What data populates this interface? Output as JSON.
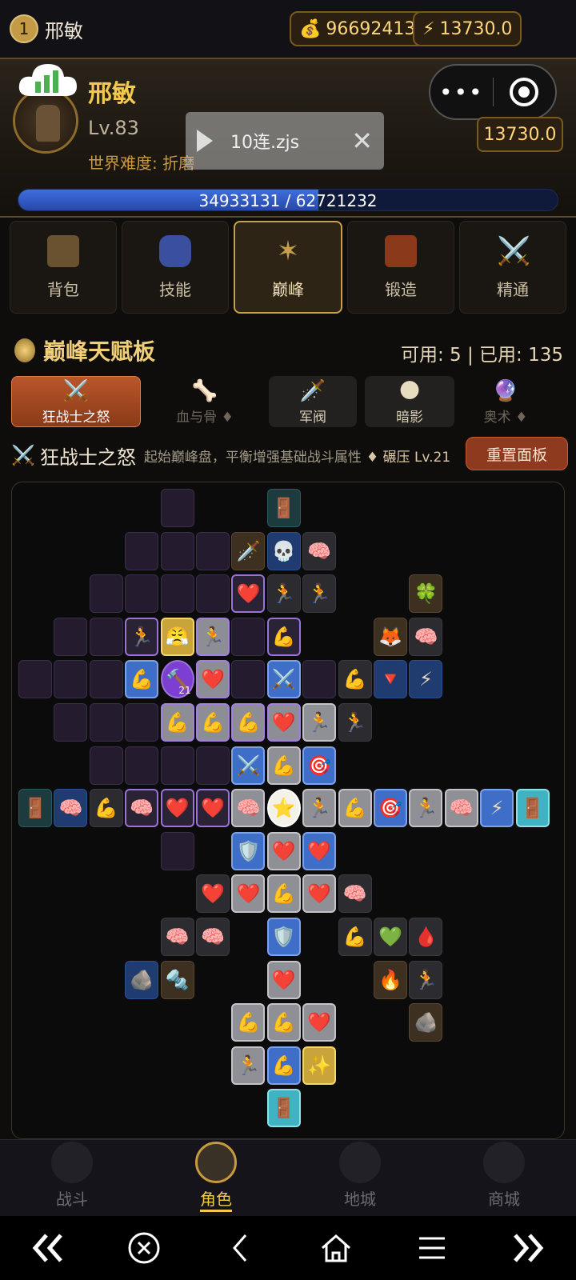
{
  "topbar": {
    "level_badge": "1",
    "player_name": "邢敏",
    "gold": "96692413",
    "energy": "13730.0"
  },
  "hero": {
    "name": "邢敏",
    "level": "Lv.83",
    "difficulty": "世界难度: 折磨",
    "energy": "13730.0",
    "xp_text": "34933131 / 62721232",
    "xp_progress": 0.557
  },
  "script_overlay": {
    "label": "10连.zjs"
  },
  "tabs": [
    {
      "label": "背包",
      "color": "#6a5230"
    },
    {
      "label": "技能",
      "color": "#3b4fa0"
    },
    {
      "label": "巅峰",
      "color": "#7a5a2a"
    },
    {
      "label": "锻造",
      "color": "#8a3a1a"
    },
    {
      "label": "精通",
      "color": "#8a8a9a"
    }
  ],
  "talent": {
    "title": "巅峰天赋板",
    "availability": "可用: 5 | 已用: 135"
  },
  "board_tabs": [
    {
      "icon": "⚔️",
      "label": "狂战士之怒"
    },
    {
      "icon": "🦴",
      "label": "血与骨 ♦"
    },
    {
      "icon": "🗡️",
      "label": "军阀"
    },
    {
      "icon": "🌑",
      "label": "暗影"
    },
    {
      "icon": "🔮",
      "label": "奥术 ♦"
    }
  ],
  "board_header": {
    "icon": "⚔️",
    "name": "狂战士之怒",
    "description": "起始巅峰盘，平衡增强基础战斗属性",
    "rune": "♦ 碾压 Lv.21",
    "reset_label": "重置面板"
  },
  "board": {
    "badge_value": "21",
    "cells": [
      {
        "c": 4,
        "r": 0,
        "s": "e"
      },
      {
        "c": 7,
        "r": 0,
        "s": "t",
        "i": "🚪"
      },
      {
        "c": 3,
        "r": 1,
        "s": "e"
      },
      {
        "c": 4,
        "r": 1,
        "s": "e"
      },
      {
        "c": 5,
        "r": 1,
        "s": "e"
      },
      {
        "c": 6,
        "r": 1,
        "s": "bn",
        "i": "🗡️"
      },
      {
        "c": 7,
        "r": 1,
        "s": "bd",
        "i": "💀"
      },
      {
        "c": 8,
        "r": 1,
        "s": "n",
        "i": "🧠"
      },
      {
        "c": 2,
        "r": 2,
        "s": "e"
      },
      {
        "c": 3,
        "r": 2,
        "s": "e"
      },
      {
        "c": 4,
        "r": 2,
        "s": "e"
      },
      {
        "c": 5,
        "r": 2,
        "s": "e"
      },
      {
        "c": 6,
        "r": 2,
        "s": "p",
        "i": "❤️"
      },
      {
        "c": 7,
        "r": 2,
        "s": "n",
        "i": "🏃"
      },
      {
        "c": 8,
        "r": 2,
        "s": "n",
        "i": "🏃"
      },
      {
        "c": 11,
        "r": 2,
        "s": "bn",
        "i": "🍀"
      },
      {
        "c": 1,
        "r": 3,
        "s": "e"
      },
      {
        "c": 2,
        "r": 3,
        "s": "e"
      },
      {
        "c": 3,
        "r": 3,
        "s": "p",
        "i": "🏃"
      },
      {
        "c": 4,
        "r": 3,
        "s": "y",
        "i": "😤"
      },
      {
        "c": 5,
        "r": 3,
        "s": "pp",
        "i": "🏃"
      },
      {
        "c": 6,
        "r": 3,
        "s": "e"
      },
      {
        "c": 7,
        "r": 3,
        "s": "p",
        "i": "💪"
      },
      {
        "c": 10,
        "r": 3,
        "s": "bn",
        "i": "🦊"
      },
      {
        "c": 11,
        "r": 3,
        "s": "n",
        "i": "🧠"
      },
      {
        "c": 0,
        "r": 4,
        "s": "e"
      },
      {
        "c": 1,
        "r": 4,
        "s": "e"
      },
      {
        "c": 2,
        "r": 4,
        "s": "e"
      },
      {
        "c": 3,
        "r": 4,
        "s": "b",
        "i": "💪"
      },
      {
        "c": 4,
        "r": 4,
        "s": "pr",
        "i": "🔨"
      },
      {
        "c": 5,
        "r": 4,
        "s": "pp",
        "i": "❤️"
      },
      {
        "c": 6,
        "r": 4,
        "s": "e"
      },
      {
        "c": 7,
        "r": 4,
        "s": "b",
        "i": "⚔️"
      },
      {
        "c": 8,
        "r": 4,
        "s": "e"
      },
      {
        "c": 9,
        "r": 4,
        "s": "n",
        "i": "💪"
      },
      {
        "c": 10,
        "r": 4,
        "s": "bd",
        "i": "🔻"
      },
      {
        "c": 11,
        "r": 4,
        "s": "bd",
        "i": "⚡"
      },
      {
        "c": 1,
        "r": 5,
        "s": "e"
      },
      {
        "c": 2,
        "r": 5,
        "s": "e"
      },
      {
        "c": 3,
        "r": 5,
        "s": "e"
      },
      {
        "c": 4,
        "r": 5,
        "s": "pp",
        "i": "💪"
      },
      {
        "c": 5,
        "r": 5,
        "s": "pp",
        "i": "💪"
      },
      {
        "c": 6,
        "r": 5,
        "s": "pp",
        "i": "💪"
      },
      {
        "c": 7,
        "r": 5,
        "s": "pp",
        "i": "❤️"
      },
      {
        "c": 8,
        "r": 5,
        "s": "g",
        "i": "🏃"
      },
      {
        "c": 9,
        "r": 5,
        "s": "n",
        "i": "🏃"
      },
      {
        "c": 2,
        "r": 6,
        "s": "e"
      },
      {
        "c": 3,
        "r": 6,
        "s": "e"
      },
      {
        "c": 4,
        "r": 6,
        "s": "e"
      },
      {
        "c": 5,
        "r": 6,
        "s": "e"
      },
      {
        "c": 6,
        "r": 6,
        "s": "b",
        "i": "⚔️"
      },
      {
        "c": 7,
        "r": 6,
        "s": "g",
        "i": "💪"
      },
      {
        "c": 8,
        "r": 6,
        "s": "b",
        "i": "🎯"
      },
      {
        "c": 0,
        "r": 7,
        "s": "t",
        "i": "🚪"
      },
      {
        "c": 1,
        "r": 7,
        "s": "bd",
        "i": "🧠"
      },
      {
        "c": 2,
        "r": 7,
        "s": "n",
        "i": "💪"
      },
      {
        "c": 3,
        "r": 7,
        "s": "p",
        "i": "🧠"
      },
      {
        "c": 4,
        "r": 7,
        "s": "p",
        "i": "❤️"
      },
      {
        "c": 5,
        "r": 7,
        "s": "p",
        "i": "❤️"
      },
      {
        "c": 6,
        "r": 7,
        "s": "g",
        "i": "🧠"
      },
      {
        "c": 7,
        "r": 7,
        "s": "w",
        "i": "⭐"
      },
      {
        "c": 8,
        "r": 7,
        "s": "g",
        "i": "🏃"
      },
      {
        "c": 9,
        "r": 7,
        "s": "g",
        "i": "💪"
      },
      {
        "c": 10,
        "r": 7,
        "s": "b",
        "i": "🎯"
      },
      {
        "c": 11,
        "r": 7,
        "s": "g",
        "i": "🏃"
      },
      {
        "c": 12,
        "r": 7,
        "s": "g",
        "i": "🧠"
      },
      {
        "c": 13,
        "r": 7,
        "s": "b",
        "i": "⚡"
      },
      {
        "c": 14,
        "r": 7,
        "s": "cy",
        "i": "🚪"
      },
      {
        "c": 4,
        "r": 8,
        "s": "e"
      },
      {
        "c": 6,
        "r": 8,
        "s": "b",
        "i": "🛡️"
      },
      {
        "c": 7,
        "r": 8,
        "s": "g",
        "i": "❤️"
      },
      {
        "c": 8,
        "r": 8,
        "s": "b",
        "i": "❤️"
      },
      {
        "c": 5,
        "r": 9,
        "s": "n",
        "i": "❤️"
      },
      {
        "c": 6,
        "r": 9,
        "s": "g",
        "i": "❤️"
      },
      {
        "c": 7,
        "r": 9,
        "s": "g",
        "i": "💪"
      },
      {
        "c": 8,
        "r": 9,
        "s": "g",
        "i": "❤️"
      },
      {
        "c": 9,
        "r": 9,
        "s": "n",
        "i": "🧠"
      },
      {
        "c": 4,
        "r": 10,
        "s": "n",
        "i": "🧠"
      },
      {
        "c": 5,
        "r": 10,
        "s": "n",
        "i": "🧠"
      },
      {
        "c": 7,
        "r": 10,
        "s": "b",
        "i": "🛡️"
      },
      {
        "c": 9,
        "r": 10,
        "s": "n",
        "i": "💪"
      },
      {
        "c": 10,
        "r": 10,
        "s": "n",
        "i": "💚"
      },
      {
        "c": 11,
        "r": 10,
        "s": "n",
        "i": "🩸"
      },
      {
        "c": 3,
        "r": 11,
        "s": "bd",
        "i": "🪨"
      },
      {
        "c": 4,
        "r": 11,
        "s": "bn",
        "i": "🔩"
      },
      {
        "c": 7,
        "r": 11,
        "s": "g",
        "i": "❤️"
      },
      {
        "c": 10,
        "r": 11,
        "s": "bn",
        "i": "🔥"
      },
      {
        "c": 11,
        "r": 11,
        "s": "n",
        "i": "🏃"
      },
      {
        "c": 6,
        "r": 12,
        "s": "g",
        "i": "💪"
      },
      {
        "c": 7,
        "r": 12,
        "s": "g",
        "i": "💪"
      },
      {
        "c": 8,
        "r": 12,
        "s": "g",
        "i": "❤️"
      },
      {
        "c": 11,
        "r": 12,
        "s": "bn",
        "i": "🪨"
      },
      {
        "c": 6,
        "r": 13,
        "s": "g",
        "i": "🏃"
      },
      {
        "c": 7,
        "r": 13,
        "s": "b",
        "i": "💪"
      },
      {
        "c": 8,
        "r": 13,
        "s": "y",
        "i": "✨"
      },
      {
        "c": 7,
        "r": 14,
        "s": "cy",
        "i": "🚪"
      }
    ]
  },
  "bottom_nav": [
    {
      "label": "战斗"
    },
    {
      "label": "角色"
    },
    {
      "label": "地城"
    },
    {
      "label": "商城"
    }
  ]
}
